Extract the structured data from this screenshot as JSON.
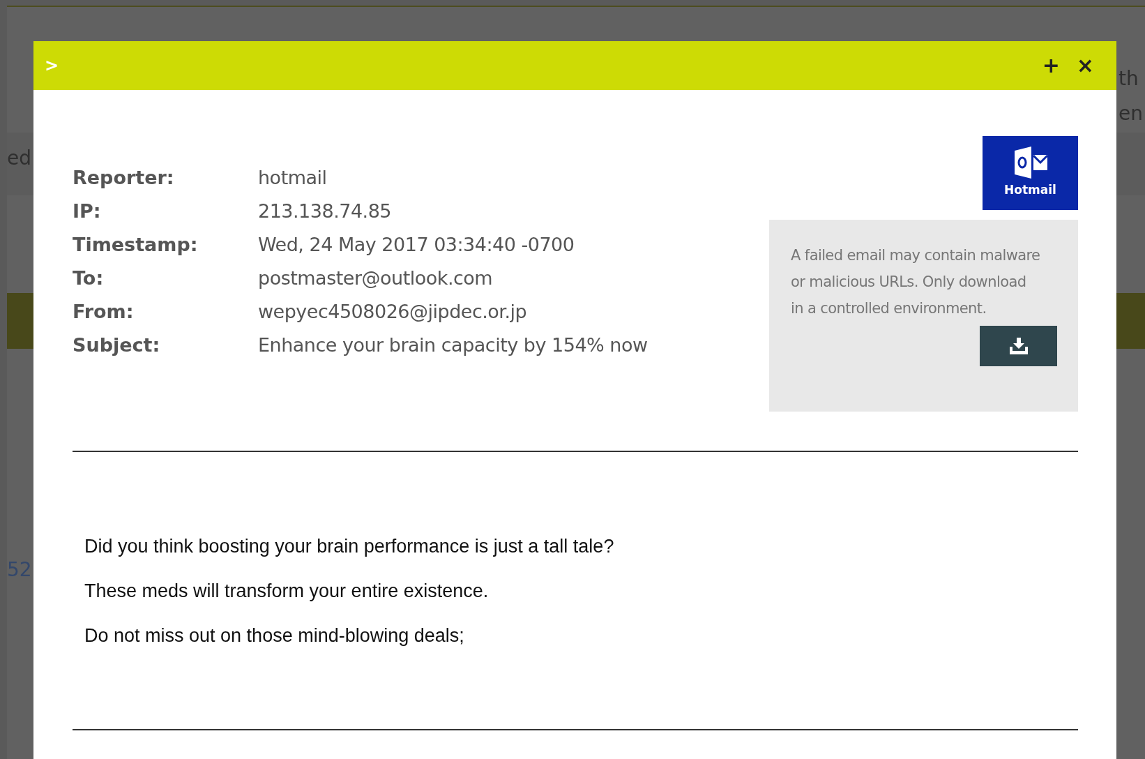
{
  "background_fragments": [
    {
      "text": "ed",
      "kind": "label"
    },
    {
      "text": "52",
      "kind": "link"
    },
    {
      "text": "th",
      "kind": "label"
    },
    {
      "text": "en",
      "kind": "label"
    }
  ],
  "modal": {
    "toggle": ">",
    "header_buttons": [
      "+",
      "×"
    ],
    "fields": [
      {
        "label": "Reporter:",
        "value": "hotmail"
      },
      {
        "label": "IP:",
        "value": "213.138.74.85"
      },
      {
        "label": "Timestamp:",
        "value": "Wed, 24 May 2017 03:34:40 -0700"
      },
      {
        "label": "To:",
        "value": "postmaster@outlook.com"
      },
      {
        "label": "From:",
        "value": "wepyec4508026@jipdec.or.jp"
      },
      {
        "label": "Subject:",
        "value": "Enhance your brain capacity by 154% now"
      }
    ],
    "provider_logo": {
      "label": "Hotmail"
    },
    "warning": "A failed email may contain malware or malicious URLs. Only download in a controlled environment.",
    "message_lines": [
      "Did you think boosting your brain performance is just a tall tale?",
      "These meds will transform your entire existence.",
      "Do not miss out on those mind-blowing deals;"
    ]
  }
}
